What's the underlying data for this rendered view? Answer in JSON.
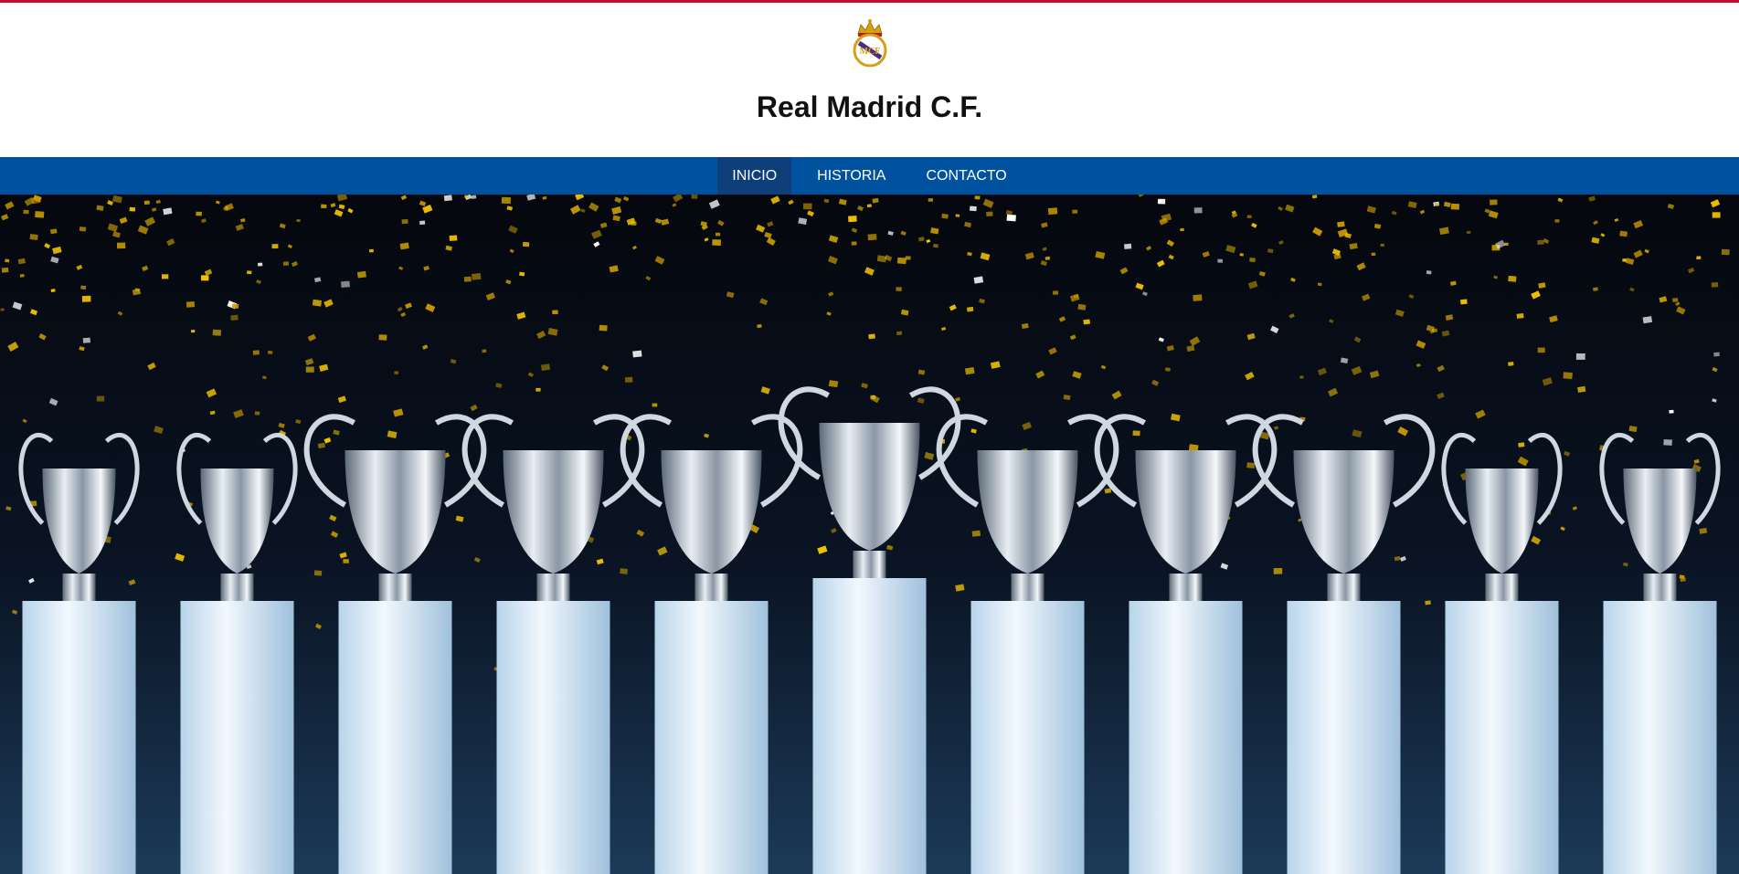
{
  "header": {
    "title": "Real Madrid C.F.",
    "crest_icon": "real-madrid-crest-icon"
  },
  "nav": {
    "items": [
      {
        "label": "INICIO",
        "active": true
      },
      {
        "label": "HISTORIA",
        "active": false
      },
      {
        "label": "CONTACTO",
        "active": false
      }
    ]
  },
  "hero": {
    "image": "champions-league-trophies-photo",
    "trophy_count": 11
  },
  "colors": {
    "accent_line": "#c8102e",
    "nav_background": "#00529f",
    "nav_active": "#0f3f7a",
    "hero_background": "#05070d",
    "confetti": "#f2c200"
  }
}
